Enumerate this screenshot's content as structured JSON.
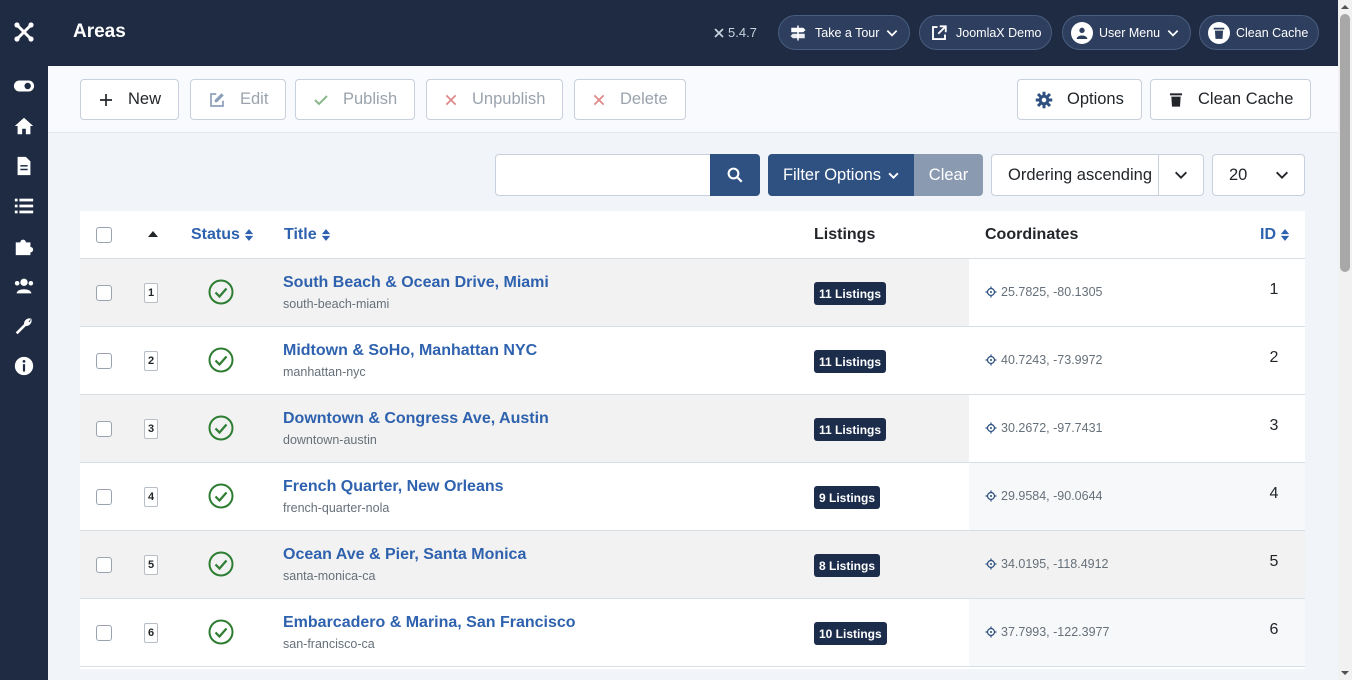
{
  "app": {
    "page_title": "Areas",
    "version": "5.4.7"
  },
  "header": {
    "tour": "Take a Tour",
    "demo": "JoomlaX Demo",
    "user_menu": "User Menu",
    "clean_cache": "Clean Cache"
  },
  "toolbar": {
    "new": "New",
    "edit": "Edit",
    "publish": "Publish",
    "unpublish": "Unpublish",
    "delete": "Delete",
    "options": "Options",
    "clean_cache": "Clean Cache"
  },
  "filters": {
    "search_value": "",
    "filter_options": "Filter Options",
    "clear": "Clear",
    "ordering": "Ordering ascending",
    "limit": "20"
  },
  "table": {
    "columns": {
      "status": "Status",
      "title": "Title",
      "listings": "Listings",
      "coordinates": "Coordinates",
      "id": "ID"
    },
    "rows": [
      {
        "order": "1",
        "title": "South Beach & Ocean Drive, Miami",
        "alias": "south-beach-miami",
        "listings": "11 Listings",
        "coords": "25.7825, -80.1305",
        "id": "1"
      },
      {
        "order": "2",
        "title": "Midtown & SoHo, Manhattan NYC",
        "alias": "manhattan-nyc",
        "listings": "11 Listings",
        "coords": "40.7243, -73.9972",
        "id": "2"
      },
      {
        "order": "3",
        "title": "Downtown & Congress Ave, Austin",
        "alias": "downtown-austin",
        "listings": "11 Listings",
        "coords": "30.2672, -97.7431",
        "id": "3"
      },
      {
        "order": "4",
        "title": "French Quarter, New Orleans",
        "alias": "french-quarter-nola",
        "listings": "9 Listings",
        "coords": "29.9584, -90.0644",
        "id": "4"
      },
      {
        "order": "5",
        "title": "Ocean Ave & Pier, Santa Monica",
        "alias": "santa-monica-ca",
        "listings": "8 Listings",
        "coords": "34.0195, -118.4912",
        "id": "5"
      },
      {
        "order": "6",
        "title": "Embarcadero & Marina, San Francisco",
        "alias": "san-francisco-ca",
        "listings": "10 Listings",
        "coords": "37.7993, -122.3977",
        "id": "6"
      }
    ]
  },
  "colors": {
    "sidebar": "#1e2b43",
    "primary": "#2f5181",
    "link": "#2f62ae",
    "published": "#2e7d32",
    "badge": "#1c2d4c"
  }
}
